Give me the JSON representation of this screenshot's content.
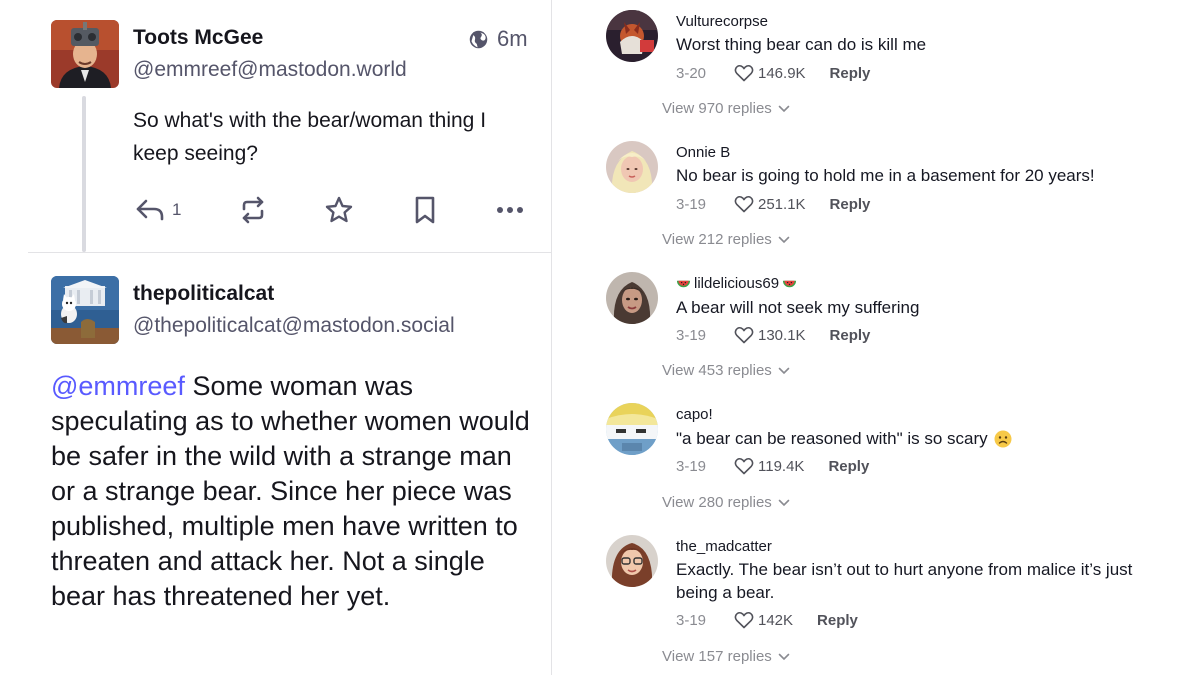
{
  "mastodon": {
    "post1": {
      "display_name": "Toots McGee",
      "handle": "@emmreef@mastodon.world",
      "time": "6m",
      "text": "So what's with the bear/woman thing I keep seeing?",
      "reply_count": "1"
    },
    "post2": {
      "display_name": "thepoliticalcat",
      "handle": "@thepoliticalcat@mastodon.social",
      "mention": "@emmreef",
      "text": " Some woman was speculating as to whether women would be safer in the wild with a strange man or a strange bear. Since her piece was published, multiple men have written to threaten and attack her. Not a single bear has threatened her yet."
    },
    "icons": [
      "globe-icon",
      "reply-icon",
      "boost-icon",
      "star-icon",
      "bookmark-icon",
      "more-icon"
    ],
    "colors": {
      "mention": "#595aff",
      "muted": "#55556a"
    }
  },
  "tiktok": {
    "reply_label": "Reply",
    "comments": [
      {
        "username": "Vulturecorpse",
        "text": "Worst thing bear can do is kill me",
        "date": "3-20",
        "likes": "146.9K",
        "view_replies": "View 970 replies"
      },
      {
        "username": "Onnie B",
        "text": "No bear is going to hold me in a basement for 20 years!",
        "date": "3-19",
        "likes": "251.1K",
        "view_replies": "View 212 replies"
      },
      {
        "username": "lildelicious69",
        "text": "A bear will not seek my suffering",
        "date": "3-19",
        "likes": "130.1K",
        "view_replies": "View 453 replies"
      },
      {
        "username": "capo!",
        "text": "\"a bear can be reasoned with\" is so scary",
        "date": "3-19",
        "likes": "119.4K",
        "view_replies": "View 280 replies"
      },
      {
        "username": "the_madcatter",
        "text": "Exactly. The bear isn’t out to hurt anyone from malice it’s just being a bear.",
        "date": "3-19",
        "likes": "142K",
        "view_replies": "View 157 replies"
      }
    ],
    "icons": [
      "heart-icon",
      "chevron-down-icon",
      "watermelon-icon",
      "frowning-face-icon"
    ]
  }
}
